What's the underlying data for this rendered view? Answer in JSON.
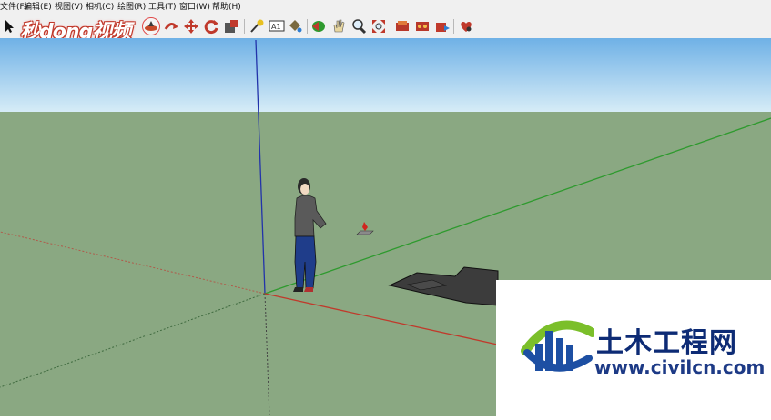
{
  "menu": [
    {
      "label": "文件(F)"
    },
    {
      "label": "编辑(E)"
    },
    {
      "label": "视图(V)"
    },
    {
      "label": "相机(C)"
    },
    {
      "label": "绘图(R)"
    },
    {
      "label": "工具(T)"
    },
    {
      "label": "窗口(W)"
    },
    {
      "label": "帮助(H)"
    }
  ],
  "toolbar": {
    "tools": [
      {
        "icon": "select-arrow-icon"
      },
      {
        "icon": "orbit-icon",
        "active": true
      },
      {
        "icon": "pan-icon"
      },
      {
        "icon": "move-icon"
      },
      {
        "icon": "rotate-icon"
      },
      {
        "icon": "scale-icon"
      },
      {
        "icon": "tape-measure-icon"
      },
      {
        "icon": "text-icon"
      },
      {
        "icon": "paint-bucket-icon"
      },
      {
        "icon": "previous-view-icon"
      },
      {
        "icon": "hand-icon"
      },
      {
        "icon": "zoom-icon"
      },
      {
        "icon": "zoom-extents-icon"
      },
      {
        "icon": "component-icon"
      },
      {
        "icon": "materials-icon"
      },
      {
        "icon": "warehouse-icon"
      },
      {
        "icon": "extension-icon"
      }
    ]
  },
  "watermark": {
    "text": "秒dong视频"
  },
  "logo": {
    "title": "土木工程网",
    "url": "www.civilcn.com",
    "colors": {
      "blue": "#1d4fa3",
      "green": "#7bbf2a",
      "navy": "#0d2b75"
    }
  },
  "scene": {
    "sky_color": "#8fc3ea",
    "ground_color": "#8aa882",
    "axis_colors": {
      "x": "#c0392b",
      "y": "#2e9a2e",
      "z": "#2233aa"
    }
  }
}
